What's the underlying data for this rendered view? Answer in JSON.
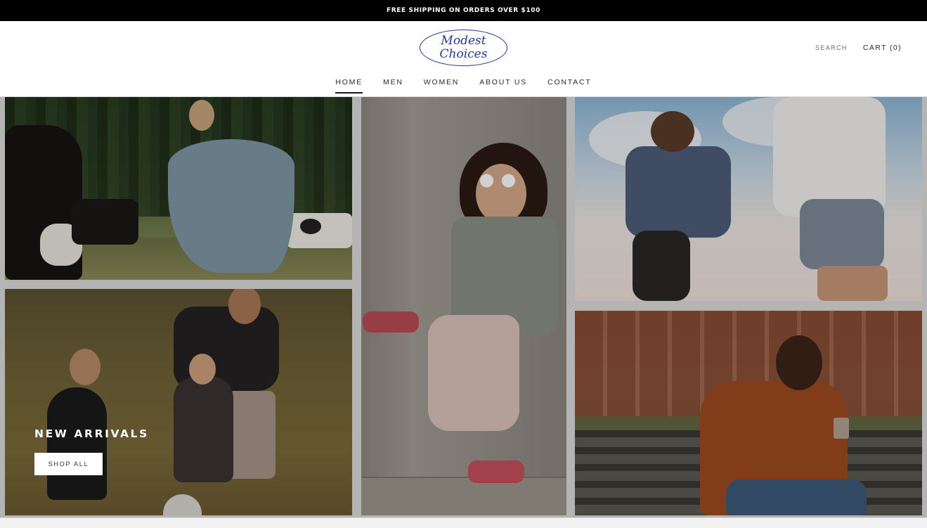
{
  "announcement": "FREE SHIPPING ON ORDERS OVER $100",
  "logo": {
    "line1": "Modest",
    "line2": "Choices"
  },
  "header": {
    "search_label": "SEARCH",
    "cart_label": "CART (0)"
  },
  "nav": {
    "items": [
      {
        "label": "HOME",
        "active": true
      },
      {
        "label": "MEN"
      },
      {
        "label": "WOMEN"
      },
      {
        "label": "ABOUT US"
      },
      {
        "label": "CONTACT"
      }
    ]
  },
  "hero": {
    "promo_title": "NEW ARRIVALS",
    "promo_button": "SHOP ALL"
  },
  "colors": {
    "announcement_bg": "#000000",
    "brand_logo": "#223a8c",
    "text": "#1c1b1b"
  }
}
